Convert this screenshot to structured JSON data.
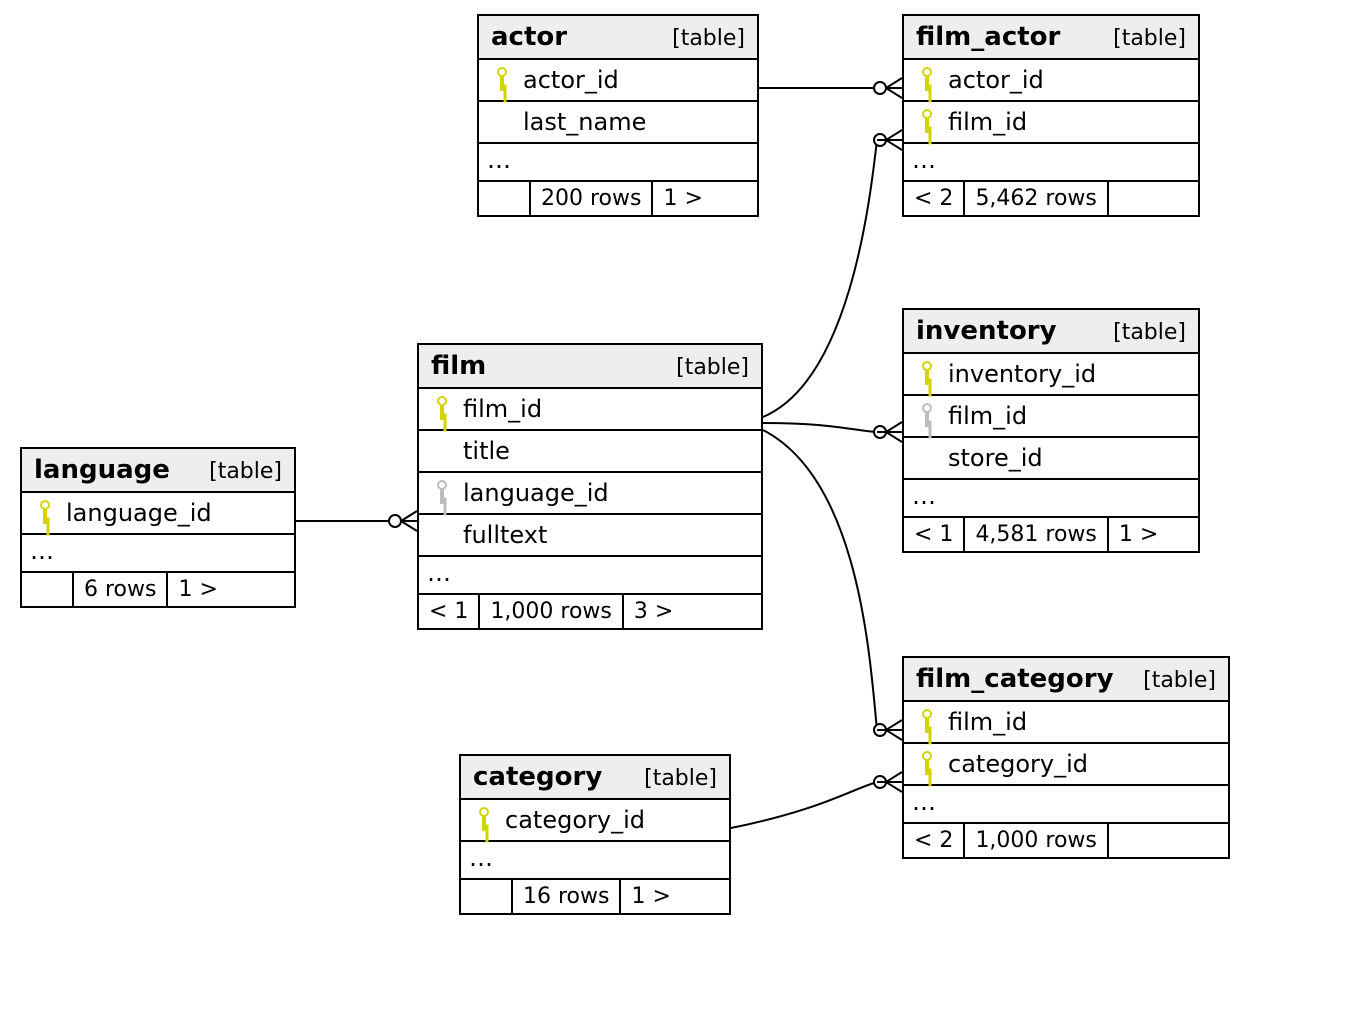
{
  "type_label": "[table]",
  "ellipsis": "…",
  "tables": {
    "actor": {
      "name": "actor",
      "columns": [
        {
          "name": "actor_id",
          "key": "pk"
        },
        {
          "name": "last_name",
          "key": null
        }
      ],
      "footer": {
        "in": "",
        "rows": "200 rows",
        "out": "1 >"
      }
    },
    "film_actor": {
      "name": "film_actor",
      "columns": [
        {
          "name": "actor_id",
          "key": "pk"
        },
        {
          "name": "film_id",
          "key": "pk"
        }
      ],
      "footer": {
        "in": "< 2",
        "rows": "5,462 rows",
        "out": ""
      }
    },
    "language": {
      "name": "language",
      "columns": [
        {
          "name": "language_id",
          "key": "pk"
        }
      ],
      "footer": {
        "in": "",
        "rows": "6 rows",
        "out": "1 >"
      }
    },
    "film": {
      "name": "film",
      "columns": [
        {
          "name": "film_id",
          "key": "pk"
        },
        {
          "name": "title",
          "key": null
        },
        {
          "name": "language_id",
          "key": "fk"
        },
        {
          "name": "fulltext",
          "key": null
        }
      ],
      "footer": {
        "in": "< 1",
        "rows": "1,000 rows",
        "out": "3 >"
      }
    },
    "inventory": {
      "name": "inventory",
      "columns": [
        {
          "name": "inventory_id",
          "key": "pk"
        },
        {
          "name": "film_id",
          "key": "fk"
        },
        {
          "name": "store_id",
          "key": null
        }
      ],
      "footer": {
        "in": "< 1",
        "rows": "4,581 rows",
        "out": "1 >"
      }
    },
    "category": {
      "name": "category",
      "columns": [
        {
          "name": "category_id",
          "key": "pk"
        }
      ],
      "footer": {
        "in": "",
        "rows": "16 rows",
        "out": "1 >"
      }
    },
    "film_category": {
      "name": "film_category",
      "columns": [
        {
          "name": "film_id",
          "key": "pk"
        },
        {
          "name": "category_id",
          "key": "pk"
        }
      ],
      "footer": {
        "in": "< 2",
        "rows": "1,000 rows",
        "out": ""
      }
    }
  },
  "relationships": [
    {
      "from": "actor.actor_id",
      "to": "film_actor.actor_id",
      "type": "one-to-many"
    },
    {
      "from": "film.film_id",
      "to": "film_actor.film_id",
      "type": "one-to-many"
    },
    {
      "from": "language.language_id",
      "to": "film.language_id",
      "type": "one-to-many"
    },
    {
      "from": "film.film_id",
      "to": "inventory.film_id",
      "type": "one-to-many"
    },
    {
      "from": "film.film_id",
      "to": "film_category.film_id",
      "type": "one-to-many"
    },
    {
      "from": "category.category_id",
      "to": "film_category.category_id",
      "type": "one-to-many"
    }
  ]
}
